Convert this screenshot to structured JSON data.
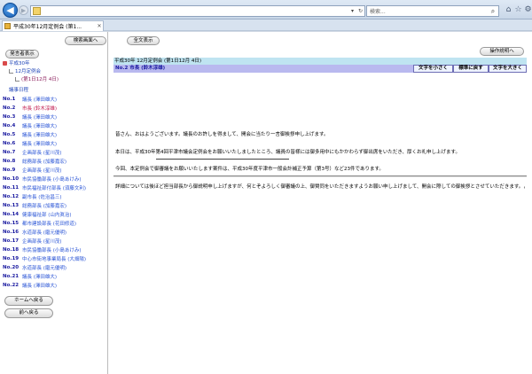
{
  "browser": {
    "search_placeholder": "検索...",
    "tab_title": "平成30年12月定例会 (第1..."
  },
  "left": {
    "kensaku_button": "検索画面へ",
    "kaigi_button": "発言者表示",
    "tree": {
      "year": "平成30年",
      "meeting": "12月定例会",
      "day": "(第1日12月 4日)"
    },
    "schedule": "議事日程",
    "speakers": [
      {
        "no": "No.1",
        "name": "議長 (澤田雄大)"
      },
      {
        "no": "No.2",
        "name": "市長 (鈴木淳雄)"
      },
      {
        "no": "No.3",
        "name": "議長 (澤田雄大)"
      },
      {
        "no": "No.4",
        "name": "議長 (澤田雄大)"
      },
      {
        "no": "No.5",
        "name": "議長 (澤田雄大)"
      },
      {
        "no": "No.6",
        "name": "議長 (澤田雄大)"
      },
      {
        "no": "No.7",
        "name": "企画部長 (星川茂)"
      },
      {
        "no": "No.8",
        "name": "総務部長 (加藤嘉宏)"
      },
      {
        "no": "No.9",
        "name": "企画部長 (星川茂)"
      },
      {
        "no": "No.10",
        "name": "市民協働部長 (小島あけみ)"
      },
      {
        "no": "No.11",
        "name": "市民福祉部付部長 (須藤文利)"
      },
      {
        "no": "No.12",
        "name": "副市長 (佐治昌三)"
      },
      {
        "no": "No.13",
        "name": "総務部長 (加藤嘉宏)"
      },
      {
        "no": "No.14",
        "name": "健康福祉部 (山内眞治)"
      },
      {
        "no": "No.15",
        "name": "都市建設部長 (花田修道)"
      },
      {
        "no": "No.16",
        "name": "水道部長 (磨元優明)"
      },
      {
        "no": "No.17",
        "name": "企画部長 (星川茂)"
      },
      {
        "no": "No.18",
        "name": "市民協働部長 (小島あけみ)"
      },
      {
        "no": "No.19",
        "name": "中心市街地事業局長 (大畑陽)"
      },
      {
        "no": "No.20",
        "name": "水道部長 (磨元優明)"
      },
      {
        "no": "No.21",
        "name": "議長 (澤田雄大)"
      },
      {
        "no": "No.22",
        "name": "議長 (澤田雄大)"
      }
    ],
    "current_index": 1,
    "home_button": "ホームへ戻る",
    "prev_button": "前へ戻る"
  },
  "main": {
    "zenbun_button": "全文表示",
    "sousa_button": "操作説明へ",
    "meeting_title": "平成30年 12月定例会 (第1日12月 4日)",
    "speaker_line": "No.2 市長 (鈴木淳雄)",
    "font_small": "文字を小さく",
    "font_reset": "標準に戻す",
    "font_large": "文字を大きく",
    "speech": [
      "皆さん、おはようございます。議長のお許しを得まして、開会に当たり一言御挨拶申し上げます。",
      "本日は、平成30年第4回平津市議会定例会をお願いいたしましたところ、議員の皆様には御多用中にもかかわらず御出席をいただき、厚くお礼申し上げます。",
      "今回、本定例会で御審議をお願いいたします案件は、平成30年度平津市一般会計補正予算（第3号）など23件であります。",
      "詳細については後ほど担当部長から御説明申し上げますが、何とぞよろしく御審議の上、御賛同をいただきますようお願い申し上げまして、開会に際しての御挨拶とさせていただきます。よろしくお願いいたします。"
    ]
  }
}
